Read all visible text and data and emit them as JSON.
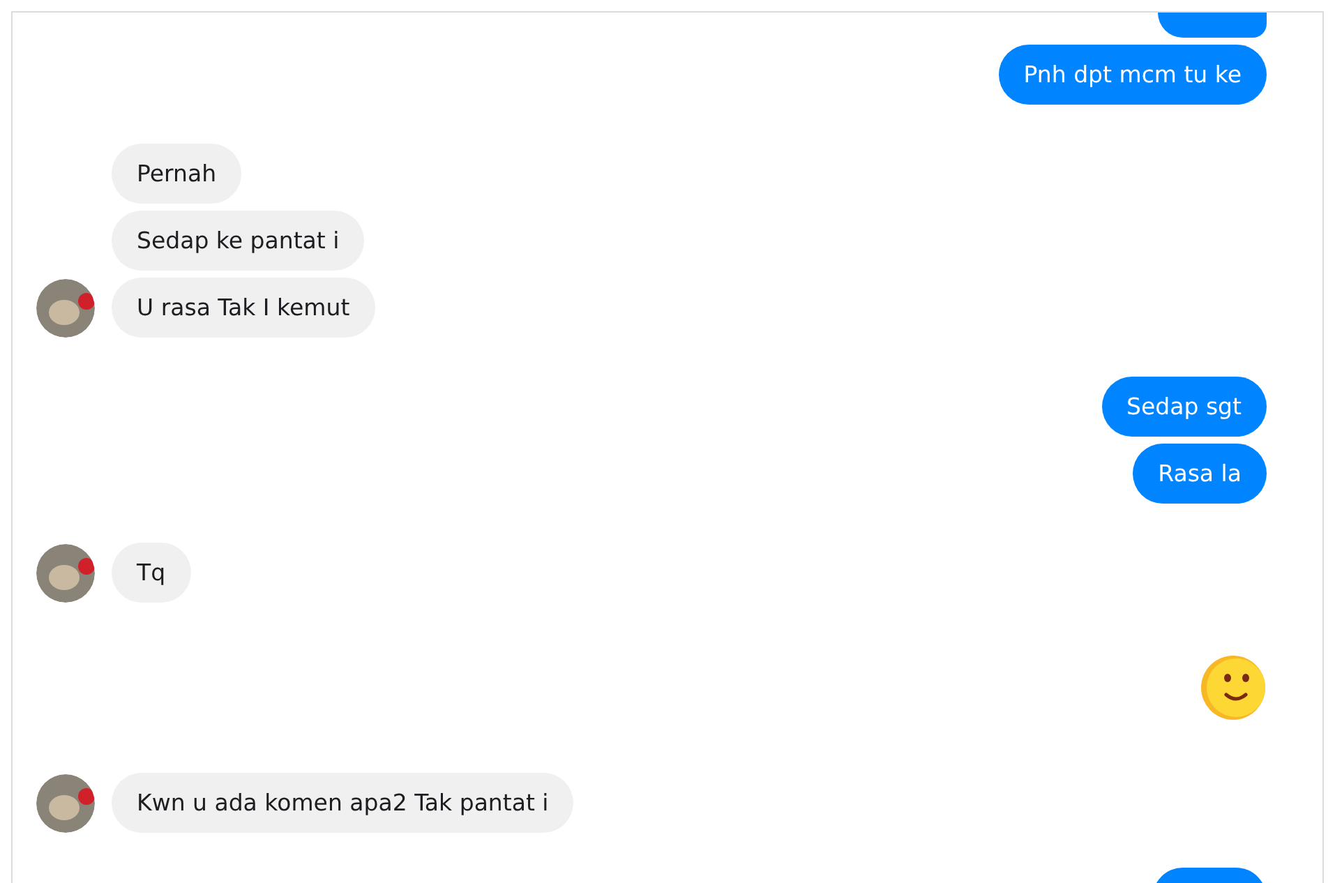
{
  "messages": [
    {
      "outgoing": true,
      "kind": "cut_top"
    },
    {
      "outgoing": true,
      "kind": "text",
      "text": "Pnh dpt mcm tu ke"
    },
    {
      "outgoing": false,
      "kind": "text",
      "text": "Pernah",
      "avatar": false
    },
    {
      "outgoing": false,
      "kind": "text",
      "text": "Sedap ke pantat i",
      "avatar": false
    },
    {
      "outgoing": false,
      "kind": "text",
      "text": "U rasa Tak I kemut",
      "avatar": true
    },
    {
      "outgoing": true,
      "kind": "text",
      "text": "Sedap sgt"
    },
    {
      "outgoing": true,
      "kind": "text",
      "text": "Rasa la"
    },
    {
      "outgoing": false,
      "kind": "text",
      "text": "Tq",
      "avatar": true
    },
    {
      "outgoing": true,
      "kind": "emoji"
    },
    {
      "outgoing": false,
      "kind": "text",
      "text": "Kwn u ada komen apa2 Tak pantat i",
      "avatar": true
    },
    {
      "outgoing": true,
      "kind": "cut_bottom"
    }
  ]
}
